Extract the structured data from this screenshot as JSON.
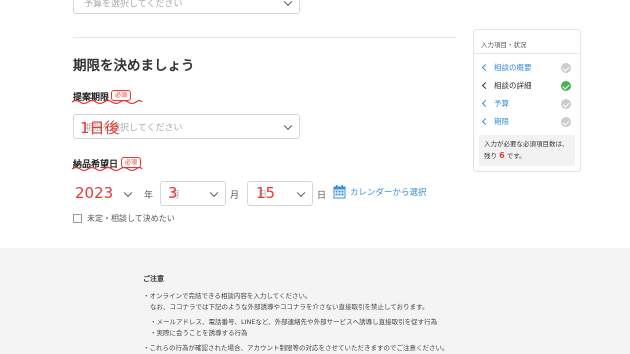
{
  "top_select": {
    "placeholder": "予算を選択してください"
  },
  "section": {
    "heading": "期限を決めましょう"
  },
  "proposal_deadline": {
    "label": "提案期限",
    "required": "必須",
    "placeholder": "期限を選択してください",
    "handwritten": "1日後"
  },
  "delivery_date": {
    "label": "納品希望日",
    "required": "必須",
    "year_value": "2023",
    "year_unit": "年",
    "month_placeholder": "月",
    "month_handwritten": "3",
    "month_unit": "月",
    "day_placeholder": "日",
    "day_handwritten": "15",
    "day_unit": "日",
    "calendar_link": "カレンダーから選択",
    "undecided_label": "未定・相談して決めたい"
  },
  "sidebar": {
    "title": "入力項目・状況",
    "items": [
      {
        "label": "相談の概要",
        "active": false,
        "done": false
      },
      {
        "label": "相談の詳細",
        "active": true,
        "done": true
      },
      {
        "label": "予算",
        "active": false,
        "done": false
      },
      {
        "label": "期限",
        "active": false,
        "done": false
      }
    ],
    "summary_prefix": "入力が必要な必須項目数は、",
    "summary_mid": "残り",
    "summary_count": "6",
    "summary_suffix": "です。"
  },
  "notes": {
    "title": "ご注意",
    "line1": "・オンラインで完結できる相談内容を入力してください。",
    "line2": "なお、ココナラでは下記のような外部誘導やココナラを介さない直接取引を禁止しております。",
    "line3": "・メールアドレス、電話番号、LINEなど、外部連絡先や外部サービスへ誘導し直接取引を促す行為",
    "line4": "・実際に会うことを誘導する行為",
    "line5": "・これらの行為が確認された場合、アカウント制限等の対応をさせていただきますのでご注意ください。"
  },
  "colors": {
    "accent_blue": "#3a8fd8",
    "check_green": "#4caf50",
    "check_gray": "#cccccc",
    "required_red": "#e33333",
    "annotation_red": "#e53935"
  }
}
